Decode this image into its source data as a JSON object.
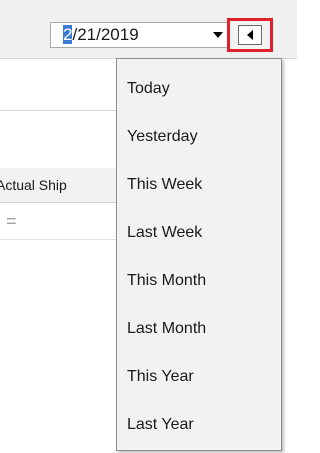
{
  "date_picker": {
    "selected_part": "2",
    "rest": "/21/2019"
  },
  "grid": {
    "column_header": "Actual Ship",
    "filter_symbol": "="
  },
  "dropdown": {
    "items": [
      "Today",
      "Yesterday",
      "This Week",
      "Last Week",
      "This Month",
      "Last Month",
      "This Year",
      "Last Year"
    ]
  },
  "colors": {
    "highlight_border": "#e0202a",
    "selection": "#3a7bd5"
  },
  "icons": {
    "dropdown": "chevron-down-icon",
    "navigate_left": "arrow-left-icon"
  }
}
